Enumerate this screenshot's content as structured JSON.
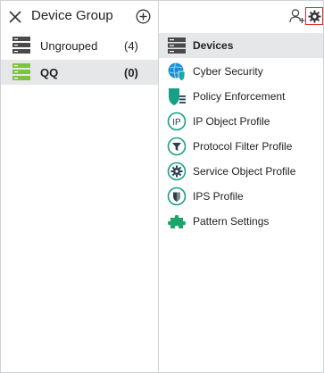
{
  "left_panel": {
    "title": "Device Group",
    "groups": [
      {
        "name": "Ungrouped",
        "count": "(4)",
        "icon": "server-rack-icon"
      },
      {
        "name": "QQ",
        "count": "(0)",
        "icon": "server-rack-green-icon"
      }
    ]
  },
  "right_panel": {
    "menu": [
      {
        "label": "Devices",
        "icon": "devices-icon"
      },
      {
        "label": "Cyber Security",
        "icon": "globe-shield-icon"
      },
      {
        "label": "Policy Enforcement",
        "icon": "policy-shield-icon"
      },
      {
        "label": "IP Object Profile",
        "icon": "ip-badge-icon",
        "icon_text": "IP"
      },
      {
        "label": "Protocol Filter Profile",
        "icon": "funnel-icon"
      },
      {
        "label": "Service Object Profile",
        "icon": "service-gear-icon"
      },
      {
        "label": "IPS Profile",
        "icon": "ips-shield-icon"
      },
      {
        "label": "Pattern Settings",
        "icon": "puzzle-icon"
      }
    ]
  },
  "colors": {
    "selected_row": "#e6e7e9",
    "accent_teal": "#1aa6a6",
    "green": "#3cb44b",
    "highlight_red": "#e0262b"
  }
}
